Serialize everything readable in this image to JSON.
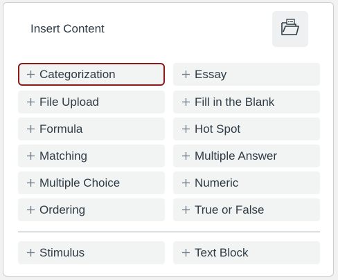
{
  "panel": {
    "title": "Insert Content",
    "folder_icon": "folder-open-icon"
  },
  "items": [
    {
      "label": "Categorization",
      "selected": true
    },
    {
      "label": "Essay"
    },
    {
      "label": "File Upload"
    },
    {
      "label": "Fill in the Blank"
    },
    {
      "label": "Formula"
    },
    {
      "label": "Hot Spot"
    },
    {
      "label": "Matching"
    },
    {
      "label": "Multiple Answer"
    },
    {
      "label": "Multiple Choice"
    },
    {
      "label": "Numeric"
    },
    {
      "label": "Ordering"
    },
    {
      "label": "True or False"
    }
  ],
  "extra_items": [
    {
      "label": "Stimulus"
    },
    {
      "label": "Text Block"
    }
  ],
  "colors": {
    "selected_border": "#8b1a1a",
    "button_bg": "#f2f4f4",
    "text": "#2d3b45"
  }
}
